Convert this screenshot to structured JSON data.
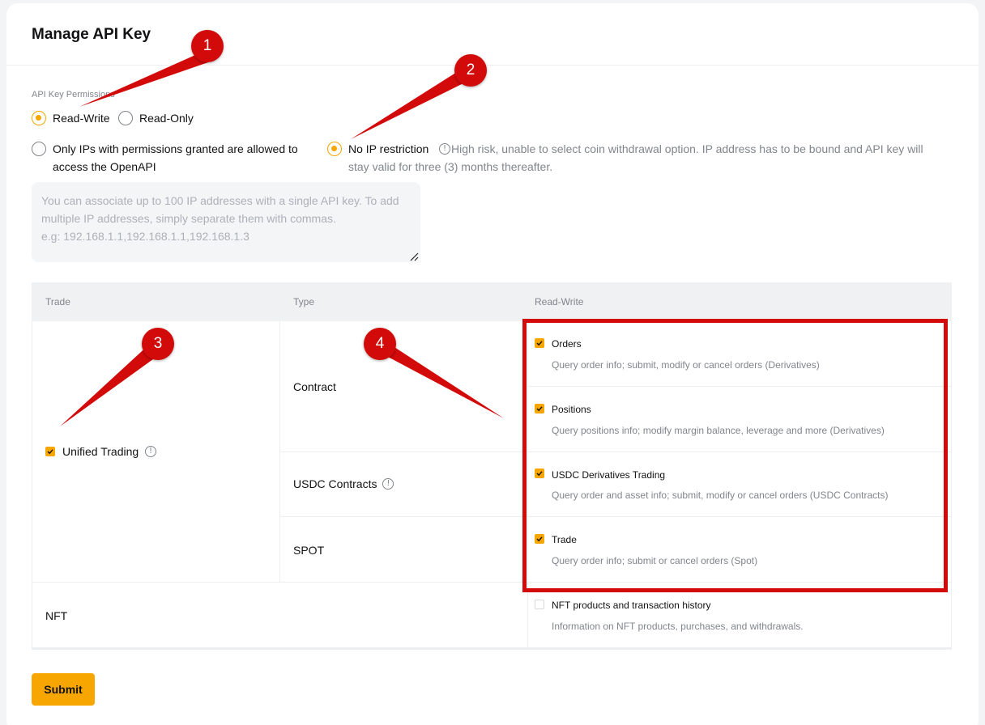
{
  "header": {
    "title": "Manage API Key"
  },
  "permissions": {
    "label": "API Key Permissions",
    "read_write": "Read-Write",
    "read_only": "Read-Only",
    "selected": "Read-Write"
  },
  "ip": {
    "only_ips_line1": "Only IPs with permissions granted are allowed to",
    "only_ips_line2": "access the OpenAPI",
    "no_restriction": "No IP restriction",
    "warning_line1": "High risk, unable to select coin withdrawal option. IP address has to be bound and API key will",
    "warning_line2": "stay valid for three (3) months thereafter.",
    "placeholder": "You can associate up to 100 IP addresses with a single API key. To add\nmultiple IP addresses, simply separate them with commas.\ne.g: 192.168.1.1,192.168.1.1,192.168.1.3",
    "selected": "No IP restriction"
  },
  "table": {
    "headers": {
      "trade": "Trade",
      "type": "Type",
      "read_write": "Read-Write"
    },
    "unified_trading": {
      "label": "Unified Trading",
      "checked": true
    },
    "types": {
      "contract": "Contract",
      "usdc": "USDC Contracts",
      "spot": "SPOT"
    },
    "perms": [
      {
        "title": "Orders",
        "desc": "Query order info; submit, modify or cancel orders (Derivatives)",
        "checked": true
      },
      {
        "title": "Positions",
        "desc": "Query positions info; modify margin balance, leverage and more (Derivatives)",
        "checked": true
      },
      {
        "title": "USDC Derivatives Trading",
        "desc": "Query order and asset info; submit, modify or cancel orders (USDC Contracts)",
        "checked": true
      },
      {
        "title": "Trade",
        "desc": "Query order info; submit or cancel orders (Spot)",
        "checked": true
      }
    ],
    "nft": {
      "label": "NFT",
      "title": "NFT products and transaction history",
      "desc": "Information on NFT products, purchases, and withdrawals.",
      "checked": false
    }
  },
  "submit_label": "Submit",
  "annotations": {
    "m1": "1",
    "m2": "2",
    "m3": "3",
    "m4": "4"
  },
  "colors": {
    "accent": "#f7a600",
    "annotation_red": "#d20a0a"
  }
}
